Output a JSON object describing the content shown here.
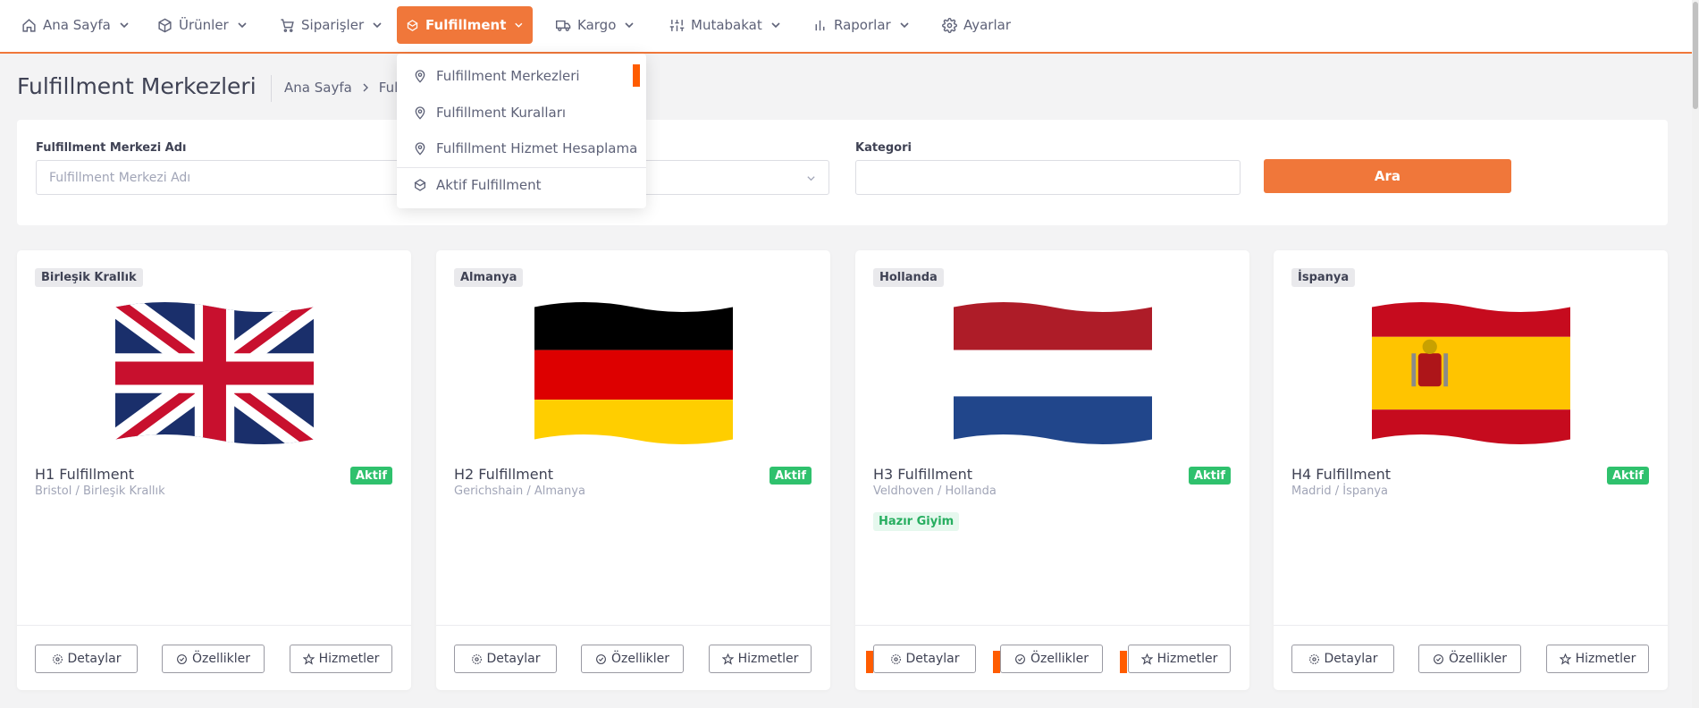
{
  "nav": {
    "items": [
      {
        "label": "Ana Sayfa"
      },
      {
        "label": "Ürünler"
      },
      {
        "label": "Siparişler"
      },
      {
        "label": "Fulfillment"
      },
      {
        "label": "Kargo"
      },
      {
        "label": "Mutabakat"
      },
      {
        "label": "Raporlar"
      },
      {
        "label": "Ayarlar"
      }
    ],
    "active": "Fulfillment"
  },
  "dropdown": {
    "items": [
      {
        "label": "Fulfillment Merkezleri",
        "icon": "map-pin-icon"
      },
      {
        "label": "Fulfillment Kuralları",
        "icon": "map-pin-icon"
      },
      {
        "label": "Fulfillment Hizmet Hesaplama",
        "icon": "map-pin-icon"
      },
      {
        "label": "Aktif Fulfillment",
        "icon": "box-icon"
      }
    ]
  },
  "page": {
    "title": "Fulfillment Merkezleri",
    "breadcrumb": [
      "Ana Sayfa",
      "Fulfi"
    ]
  },
  "filters": {
    "name_label": "Fulfillment Merkezi Adı",
    "name_placeholder": "Fulfillment Merkezi Adı",
    "name_value": "",
    "country_value": "",
    "category_label": "Kategori",
    "category_value": "",
    "search_label": "Ara"
  },
  "cards": [
    {
      "country": "Birleşik Krallık",
      "name": "H1 Fulfillment",
      "status": "Aktif",
      "location": "Bristol / Birleşik Krallık",
      "category": "",
      "flag": "uk-flag"
    },
    {
      "country": "Almanya",
      "name": "H2 Fulfillment",
      "status": "Aktif",
      "location": "Gerichshain / Almanya",
      "category": "",
      "flag": "germany-flag"
    },
    {
      "country": "Hollanda",
      "name": "H3 Fulfillment",
      "status": "Aktif",
      "location": "Veldhoven / Hollanda",
      "category": "Hazır Giyim",
      "flag": "netherlands-flag"
    },
    {
      "country": "İspanya",
      "name": "H4 Fulfillment",
      "status": "Aktif",
      "location": "Madrid / İspanya",
      "category": "",
      "flag": "spain-flag"
    }
  ],
  "card_buttons": {
    "details": "Detaylar",
    "features": "Özellikler",
    "services": "Hizmetler"
  },
  "colors": {
    "accent": "#f0773a",
    "active_badge": "#2fc16d",
    "marker": "#ff5c00"
  }
}
